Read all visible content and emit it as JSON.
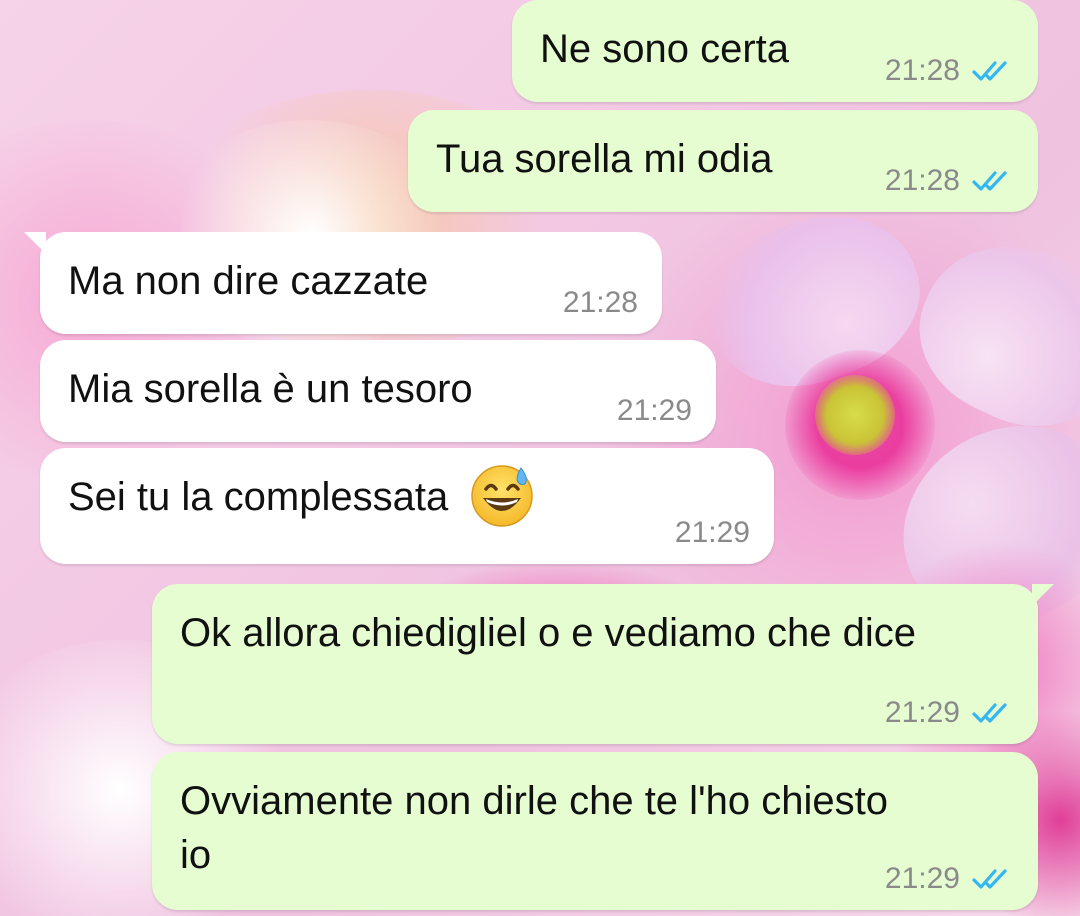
{
  "colors": {
    "outgoing_bubble": "#e6fdd2",
    "incoming_bubble": "#ffffff",
    "timestamp": "#8a8a8a",
    "read_ticks": "#34b7f1"
  },
  "messages": [
    {
      "direction": "out",
      "text": "Ne sono certa",
      "time": "21:28",
      "status_icon": "double-check-read-icon"
    },
    {
      "direction": "out",
      "text": "Tua sorella mi odia",
      "time": "21:28",
      "status_icon": "double-check-read-icon"
    },
    {
      "direction": "in",
      "text": "Ma non dire cazzate",
      "time": "21:28"
    },
    {
      "direction": "in",
      "text": "Mia sorella è un tesoro",
      "time": "21:29"
    },
    {
      "direction": "in",
      "text": "Sei tu la complessata",
      "emoji": "grinning-face-with-sweat-emoji",
      "time": "21:29"
    },
    {
      "direction": "out",
      "text": "Ok allora chiedigliel o e vediamo che dice",
      "time": "21:29",
      "status_icon": "double-check-read-icon"
    },
    {
      "direction": "out",
      "text": "Ovviamente non dirle che te l'ho chiesto io",
      "time": "21:29",
      "status_icon": "double-check-read-icon"
    }
  ]
}
